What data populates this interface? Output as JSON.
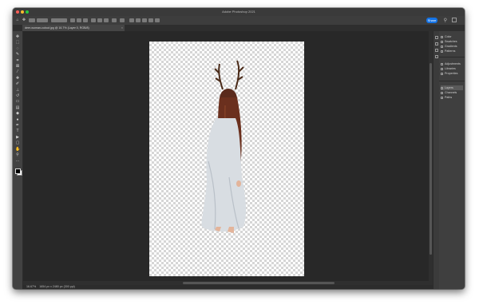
{
  "window": {
    "title": "Adobe Photoshop 2021",
    "colors": {
      "close": "#ff5f57",
      "minimize": "#febc2e",
      "zoom": "#28c840"
    }
  },
  "options_bar": {
    "home_icon": "home-icon",
    "share_label": "Share",
    "search_icon": "search-icon",
    "workspace_icon": "workspace-icon"
  },
  "document_tab": {
    "label": "deer-woman-cutout.jpg @ 16.7% (Layer 0, RGB/8)",
    "close": "×"
  },
  "tools": [
    {
      "name": "move-tool-icon",
      "glyph": "✥"
    },
    {
      "name": "marquee-tool-icon",
      "glyph": "⬚"
    },
    {
      "name": "lasso-tool-icon",
      "glyph": "◌"
    },
    {
      "name": "quick-select-tool-icon",
      "glyph": "✎"
    },
    {
      "name": "crop-tool-icon",
      "glyph": "⌗"
    },
    {
      "name": "frame-tool-icon",
      "glyph": "⊠"
    },
    {
      "name": "eyedropper-tool-icon",
      "glyph": "⁄"
    },
    {
      "name": "healing-brush-tool-icon",
      "glyph": "✚"
    },
    {
      "name": "brush-tool-icon",
      "glyph": "✐"
    },
    {
      "name": "clone-stamp-tool-icon",
      "glyph": "⊥"
    },
    {
      "name": "history-brush-tool-icon",
      "glyph": "↺"
    },
    {
      "name": "eraser-tool-icon",
      "glyph": "▭"
    },
    {
      "name": "gradient-tool-icon",
      "glyph": "▤"
    },
    {
      "name": "blur-tool-icon",
      "glyph": "◆"
    },
    {
      "name": "dodge-tool-icon",
      "glyph": "●"
    },
    {
      "name": "pen-tool-icon",
      "glyph": "✒"
    },
    {
      "name": "type-tool-icon",
      "glyph": "T"
    },
    {
      "name": "path-select-tool-icon",
      "glyph": "▶"
    },
    {
      "name": "rectangle-tool-icon",
      "glyph": "▢"
    },
    {
      "name": "hand-tool-icon",
      "glyph": "✋"
    },
    {
      "name": "zoom-tool-icon",
      "glyph": "⚲"
    },
    {
      "name": "more-tools-icon",
      "glyph": "…"
    }
  ],
  "panels": {
    "group1": [
      "Color",
      "Swatches",
      "Gradients",
      "Patterns"
    ],
    "group2": [
      "Adjustments",
      "Libraries",
      "Properties"
    ],
    "group3": [
      "Layers",
      "Channels",
      "Paths"
    ],
    "active": "Layers"
  },
  "status_bar": {
    "zoom": "16.67%",
    "info": "1654 px x 2480 px (300 ppi)"
  },
  "colors": {
    "canvas_bg": "#282828",
    "share_accent": "#1473e6"
  }
}
